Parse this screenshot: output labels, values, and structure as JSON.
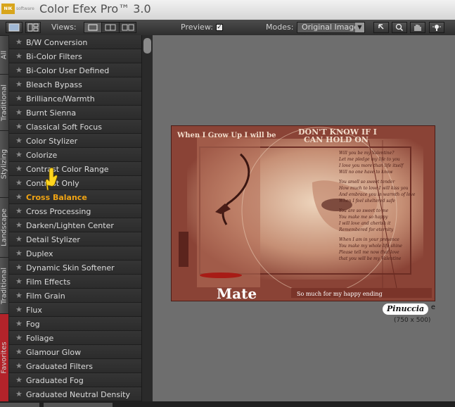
{
  "app": {
    "title": "Color Efex Pro™ 3.0",
    "logo_text": "NIK",
    "logo_sub": "software"
  },
  "toolbar": {
    "views_label": "Views:",
    "preview_label": "Preview:",
    "preview_checked": "✓",
    "modes_label": "Modes:",
    "mode_value": "Original Image",
    "tools": [
      "arrow-tool",
      "zoom-tool",
      "hand-tool",
      "light-tool"
    ]
  },
  "side_tabs": [
    "All",
    "Traditional",
    "Stylizing",
    "Landscape",
    "Traditional",
    "Favorites"
  ],
  "filters": {
    "selected": "Cross Balance",
    "items": [
      "B/W Conversion",
      "Bi-Color Filters",
      "Bi-Color User Defined",
      "Bleach Bypass",
      "Brilliance/Warmth",
      "Burnt Sienna",
      "Classical Soft Focus",
      "Color Stylizer",
      "Colorize",
      "Contrast Color Range",
      "Contrast Only",
      "Cross Balance",
      "Cross Processing",
      "Darken/Lighten Center",
      "Detail Stylizer",
      "Duplex",
      "Dynamic Skin Softener",
      "Film Effects",
      "Film Grain",
      "Flux",
      "Fog",
      "Foliage",
      "Glamour Glow",
      "Graduated Filters",
      "Graduated Fog",
      "Graduated Neutral Density"
    ]
  },
  "preview": {
    "image_text": {
      "top_left": "When I Grow Up I will be",
      "top_right_1": "DON'T KNOW IF I",
      "top_right_2": "CAN HOLD ON",
      "big_word": "Mate",
      "tagline": "So much for my happy ending",
      "poem": [
        "Will you be my Valentine?",
        "Let me pledge my life to you",
        "I love you more than life itself",
        "Will no one have to know",
        "You smell so sweet tender",
        "How much to love I will kiss you",
        "And embrace you in warmth of love",
        "When I feel sheltered safe",
        "You are so sweet to me",
        "You make me so happy",
        "I will love and cherish it",
        "Remembered for eternity",
        "When I am in your presence",
        "You make my whole life shine",
        "Please tell me now that love",
        "that you will be my Valentine"
      ]
    },
    "signature": "Pinuccia",
    "filename_suffix": "e",
    "dimensions": "(750 x 500)"
  }
}
